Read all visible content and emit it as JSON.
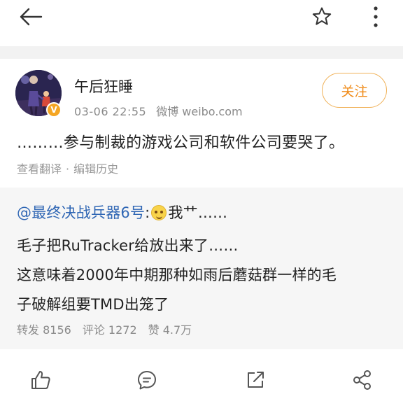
{
  "header": {
    "back_icon": "back-arrow-icon",
    "favorite_icon": "star-icon",
    "more_icon": "more-vertical-icon"
  },
  "post": {
    "username": "午后狂睡",
    "verified_badge": "V",
    "time": "03-06 22:55",
    "source": "微博 weibo.com",
    "follow_label": "关注",
    "text": "………参与制裁的游戏公司和软件公司要哭了。",
    "translate_label": "查看翻译",
    "separator": "·",
    "edit_history_label": "编辑历史"
  },
  "repost": {
    "mention": "@最终决战兵器6号",
    "colon": ":",
    "line1_suffix": "我艹……",
    "line2": "毛子把RuTracker给放出来了……",
    "line3": "这意味着2000年中期那种如雨后蘑菇群一样的毛",
    "line4": "子破解组要TMD出笼了",
    "stats": {
      "reposts": "转发 8156",
      "comments": "评论 1272",
      "likes": "赞 4.7万"
    }
  },
  "toolbar": {
    "like_icon": "thumbs-up-icon",
    "comment_icon": "comment-icon",
    "repost_icon": "repost-icon",
    "share_icon": "share-icon"
  },
  "colors": {
    "accent_follow": "#f08c1a",
    "mention_blue": "#2f66b4",
    "background": "#f2f2f2"
  }
}
